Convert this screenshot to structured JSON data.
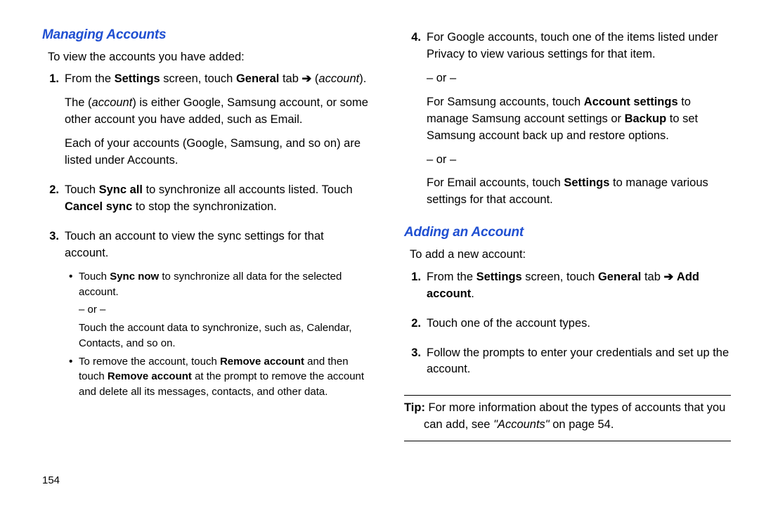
{
  "pageNumber": "154",
  "arrow": "➔",
  "left": {
    "heading": "Managing Accounts",
    "intro": "To view the accounts you have added:",
    "s1": {
      "num": "1.",
      "a1": "From the ",
      "a2": "Settings",
      "a3": " screen, touch ",
      "a4": "General",
      "a5": " tab ",
      "a6": "(",
      "a7": "account",
      "a8": ").",
      "b1": "The (",
      "b2": "account",
      "b3": ") is either Google, Samsung account, or some other account you have added, such as Email.",
      "c": "Each of your accounts (Google, Samsung, and so on) are listed under Accounts."
    },
    "s2": {
      "num": "2.",
      "a1": "Touch ",
      "a2": "Sync all",
      "a3": " to synchronize all accounts listed. Touch ",
      "a4": "Cancel sync",
      "a5": " to stop the synchronization."
    },
    "s3": {
      "num": "3.",
      "a": "Touch an account to view the sync settings for that account.",
      "bul1a": "Touch ",
      "bul1b": "Sync now",
      "bul1c": " to synchronize all data for the selected account.",
      "or": "– or –",
      "bul1d": "Touch the account data to synchronize, such as, Calendar, Contacts, and so on.",
      "bul2a": "To remove the account, touch ",
      "bul2b": "Remove account",
      "bul2c": " and then touch ",
      "bul2d": "Remove account",
      "bul2e": " at the prompt to remove the account and delete all its messages, contacts, and other data."
    }
  },
  "right": {
    "s4": {
      "num": "4.",
      "a": "For Google accounts, touch one of the items listed under Privacy to view various settings for that item.",
      "or": "– or –",
      "b1": "For Samsung accounts, touch ",
      "b2": "Account settings",
      "b3": " to manage Samsung account settings or ",
      "b4": "Backup",
      "b5": " to set Samsung account back up and restore options.",
      "c1": "For Email accounts, touch ",
      "c2": "Settings",
      "c3": " to manage various settings for that account."
    },
    "heading": "Adding an Account",
    "intro": "To add a new account:",
    "a1": {
      "num": "1.",
      "t1": "From the ",
      "t2": "Settings",
      "t3": " screen, touch ",
      "t4": "General",
      "t5": " tab ",
      "t6": "Add account",
      "t7": "."
    },
    "a2": {
      "num": "2.",
      "t": "Touch one of the account types."
    },
    "a3": {
      "num": "3.",
      "t": "Follow the prompts to enter your credentials and set up the account."
    },
    "tip": {
      "label": "Tip:",
      "t1": " For more information about the types of accounts that you",
      "t2": "can add, see ",
      "t3": "\"Accounts\"",
      "t4": " on page 54."
    }
  }
}
